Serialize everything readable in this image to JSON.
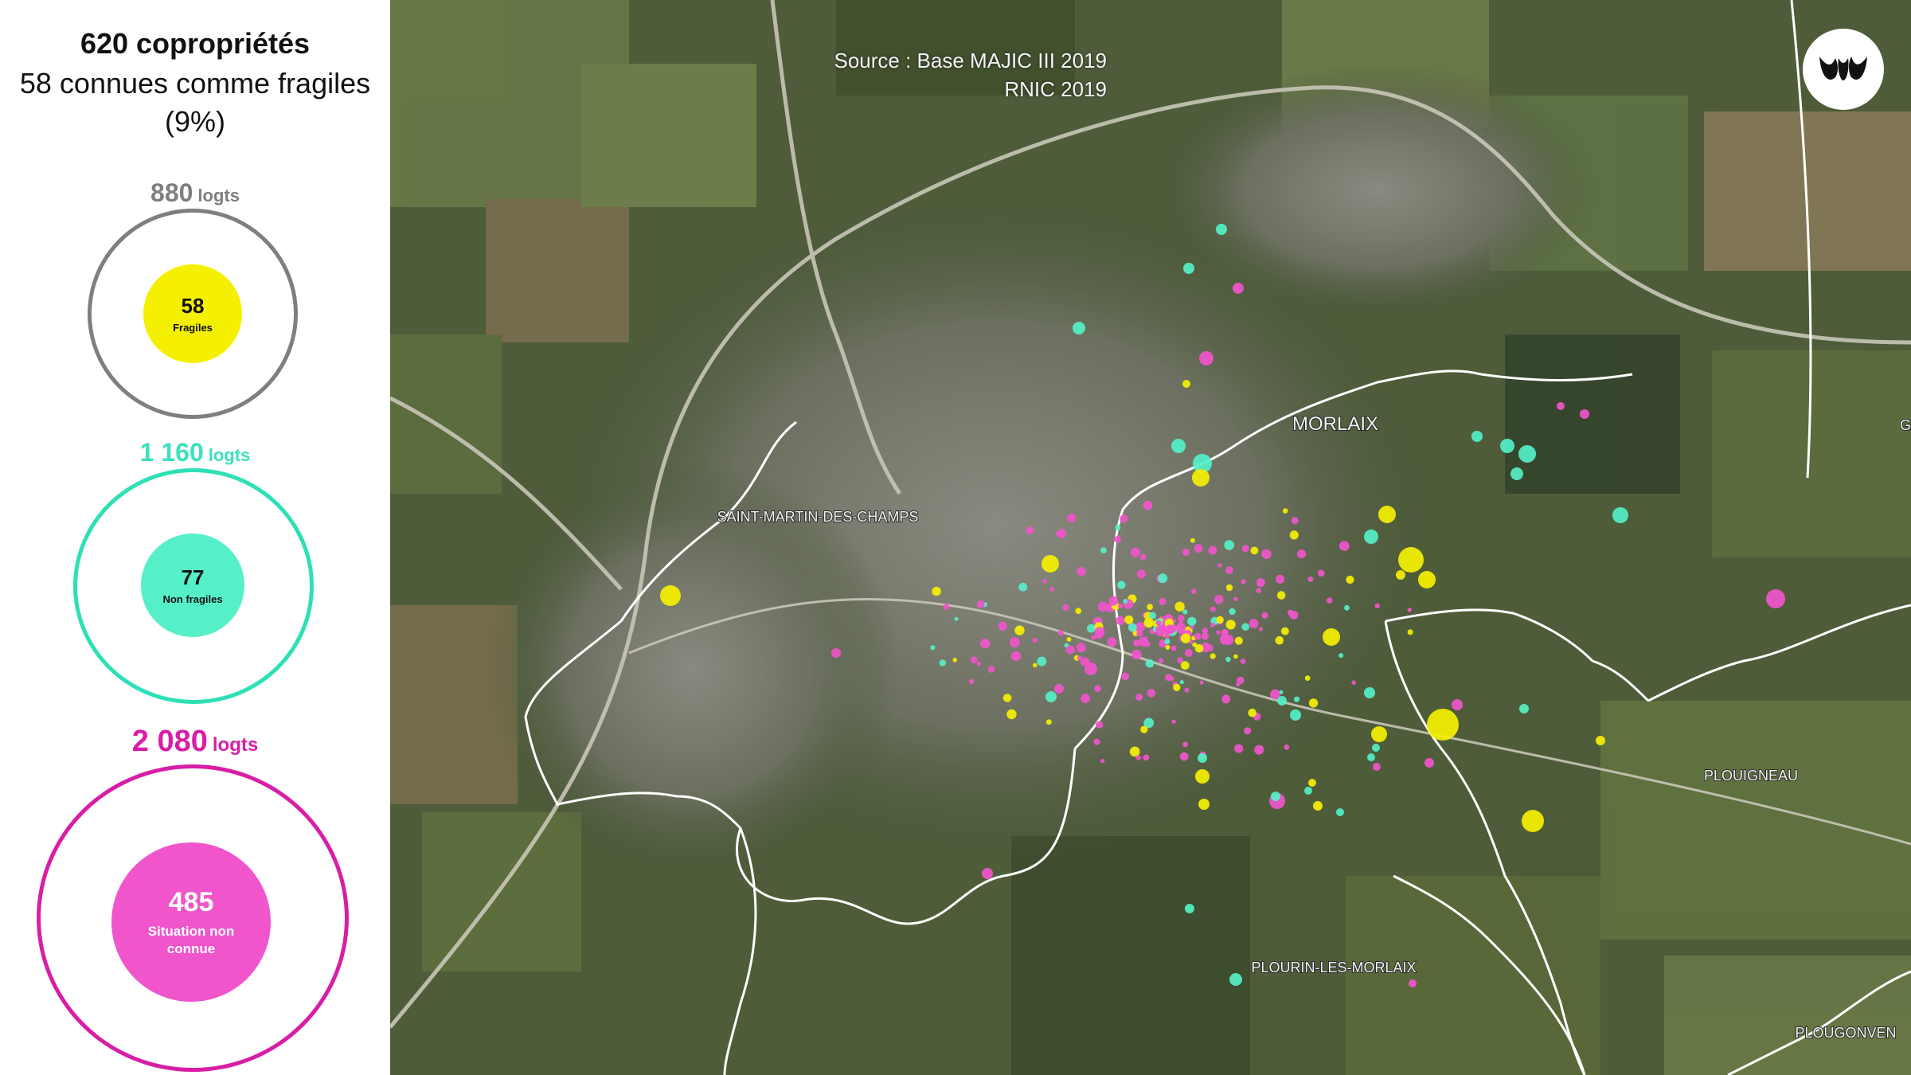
{
  "summary": {
    "title": "620 copropriétés",
    "subtitle": "58 connues comme fragiles",
    "percent": "(9%)"
  },
  "groups": [
    {
      "logts_value": "880",
      "logts_unit": "logts",
      "count": "58",
      "label": "Fragiles",
      "ring_color": "#7f7f7f",
      "text_color": "#7f7f7f",
      "fill_color": "#f5f000"
    },
    {
      "logts_value": "1 160",
      "logts_unit": "logts",
      "count": "77",
      "label": "Non fragiles",
      "ring_color": "#2de0b5",
      "text_color": "#3ee0bd",
      "fill_color": "#55f0c8"
    },
    {
      "logts_value": "2 080",
      "logts_unit": "logts",
      "count": "485",
      "label": "Situation non connue",
      "ring_color": "#d81ea6",
      "text_color": "#d81ea6",
      "fill_color": "#f055cc"
    }
  ],
  "map": {
    "source_line1": "Source : Base MAJIC III 2019",
    "source_line2": "RNIC 2019",
    "places": {
      "morlaix": "MORLAIX",
      "saint_martin": "SAINT-MARTIN-DES-CHAMPS",
      "ploujean": "PLOUIGNEAU",
      "plourin": "PLOURIN-LES-MORLAIX",
      "plougonven": "PLOUGONVEN",
      "garlan": "GA"
    },
    "logo_icon": "brand-logo-icon"
  }
}
